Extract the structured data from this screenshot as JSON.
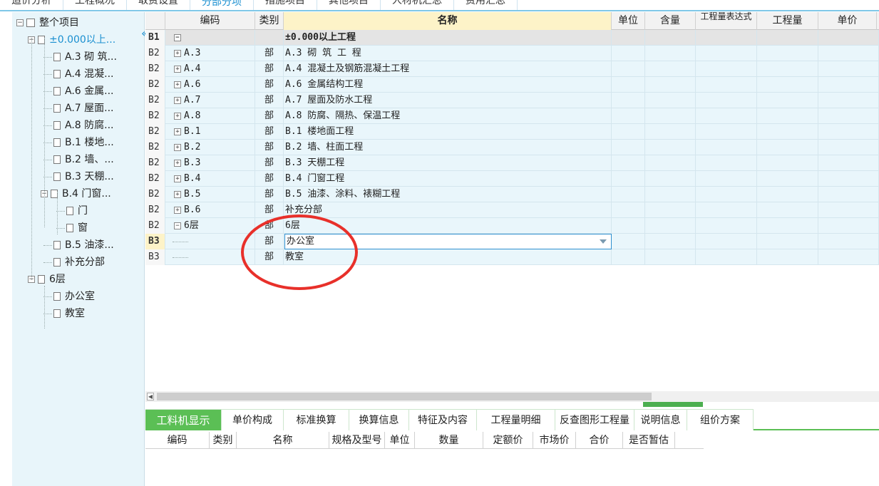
{
  "top_tabs": [
    "造价分析",
    "工程概况",
    "取费设置",
    "分部分项",
    "措施项目",
    "其他项目",
    "人材机汇总",
    "费用汇总"
  ],
  "top_tab_active": 3,
  "tree": {
    "root": "整个项目",
    "items": [
      {
        "label": "±0.000以上...",
        "level": 1,
        "expand": "−",
        "selected": true
      },
      {
        "label": "A.3 砌 筑...",
        "level": 2
      },
      {
        "label": "A.4 混凝...",
        "level": 2
      },
      {
        "label": "A.6 金属...",
        "level": 2
      },
      {
        "label": "A.7 屋面...",
        "level": 2
      },
      {
        "label": "A.8 防腐...",
        "level": 2
      },
      {
        "label": "B.1 楼地...",
        "level": 2
      },
      {
        "label": "B.2 墙、...",
        "level": 2
      },
      {
        "label": "B.3 天棚...",
        "level": 2
      },
      {
        "label": "B.4 门窗...",
        "level": 2,
        "expand": "−"
      },
      {
        "label": "门",
        "level": 3
      },
      {
        "label": "窗",
        "level": 3
      },
      {
        "label": "B.5 油漆...",
        "level": 2
      },
      {
        "label": "补充分部",
        "level": 2
      },
      {
        "label": "6层",
        "level": 1,
        "expand": "−"
      },
      {
        "label": "办公室",
        "level": 2
      },
      {
        "label": "教室",
        "level": 2
      }
    ]
  },
  "grid": {
    "headers": {
      "code": "编码",
      "type": "类别",
      "name": "名称",
      "unit": "单位",
      "content": "含量",
      "expr": "工程量表达式",
      "qty": "工程量",
      "price": "单价"
    },
    "rows": [
      {
        "rh": "B1",
        "code": "",
        "expand": "−",
        "type": "",
        "name": "±0.000以上工程"
      },
      {
        "rh": "B2",
        "code": "A.3",
        "expand": "+",
        "type": "部",
        "name": "A.3  砌 筑 工 程"
      },
      {
        "rh": "B2",
        "code": "A.4",
        "expand": "+",
        "type": "部",
        "name": "A.4  混凝土及钢筋混凝土工程"
      },
      {
        "rh": "B2",
        "code": "A.6",
        "expand": "+",
        "type": "部",
        "name": "A.6  金属结构工程"
      },
      {
        "rh": "B2",
        "code": "A.7",
        "expand": "+",
        "type": "部",
        "name": "A.7  屋面及防水工程"
      },
      {
        "rh": "B2",
        "code": "A.8",
        "expand": "+",
        "type": "部",
        "name": "A.8  防腐、隔热、保温工程"
      },
      {
        "rh": "B2",
        "code": "B.1",
        "expand": "+",
        "type": "部",
        "name": "B.1  楼地面工程"
      },
      {
        "rh": "B2",
        "code": "B.2",
        "expand": "+",
        "type": "部",
        "name": "B.2  墙、柱面工程"
      },
      {
        "rh": "B2",
        "code": "B.3",
        "expand": "+",
        "type": "部",
        "name": "B.3  天棚工程"
      },
      {
        "rh": "B2",
        "code": "B.4",
        "expand": "+",
        "type": "部",
        "name": "B.4  门窗工程"
      },
      {
        "rh": "B2",
        "code": "B.5",
        "expand": "+",
        "type": "部",
        "name": "B.5  油漆、涂料、裱糊工程"
      },
      {
        "rh": "B2",
        "code": "B.6",
        "expand": "+",
        "type": "部",
        "name": "补充分部"
      },
      {
        "rh": "B2",
        "code": "6层",
        "expand": "−",
        "type": "部",
        "name": "6层"
      },
      {
        "rh": "B3",
        "code": "",
        "expand": "",
        "type": "部",
        "name": "办公室",
        "editing": true
      },
      {
        "rh": "B3",
        "code": "",
        "expand": "",
        "type": "部",
        "name": "教室"
      }
    ]
  },
  "bottom_tabs": [
    "工料机显示",
    "单价构成",
    "标准换算",
    "换算信息",
    "特征及内容",
    "工程量明细",
    "反查图形工程量",
    "说明信息",
    "组价方案"
  ],
  "bottom_tab_active": 0,
  "bottom_headers": [
    "编码",
    "类别",
    "名称",
    "规格及型号",
    "单位",
    "数量",
    "定额价",
    "市场价",
    "合价",
    "是否暂估"
  ],
  "colors": {
    "accent": "#1a8fd0",
    "green": "#5bbf55",
    "annotation": "#e8302a",
    "row_bg": "#e9f6fb"
  }
}
